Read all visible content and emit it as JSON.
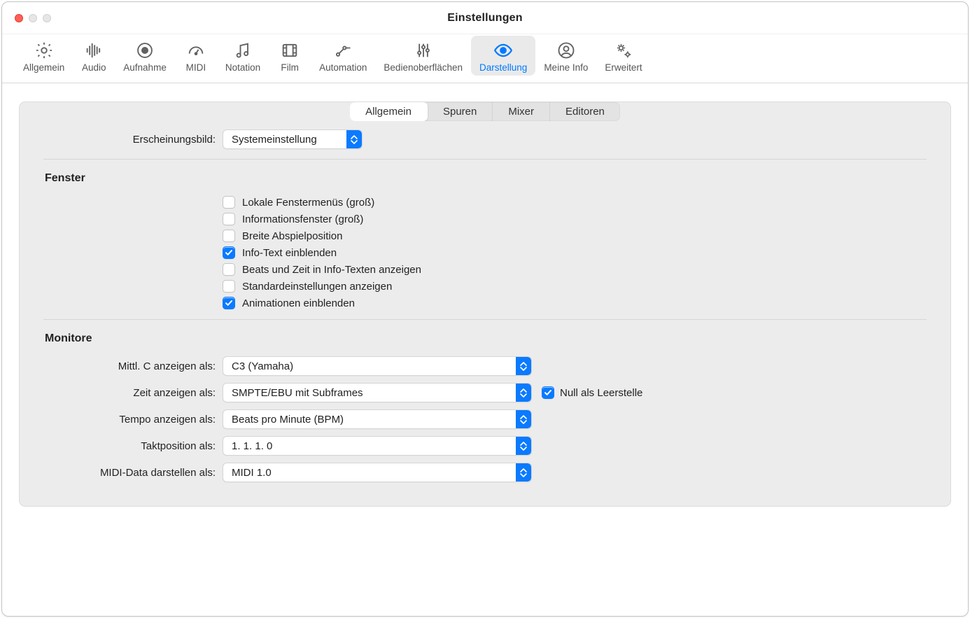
{
  "window": {
    "title": "Einstellungen"
  },
  "toolbar": {
    "items": [
      {
        "label": "Allgemein"
      },
      {
        "label": "Audio"
      },
      {
        "label": "Aufnahme"
      },
      {
        "label": "MIDI"
      },
      {
        "label": "Notation"
      },
      {
        "label": "Film"
      },
      {
        "label": "Automation"
      },
      {
        "label": "Bedienoberflächen"
      },
      {
        "label": "Darstellung"
      },
      {
        "label": "Meine Info"
      },
      {
        "label": "Erweitert"
      }
    ],
    "active_index": 8
  },
  "subtabs": {
    "items": [
      {
        "label": "Allgemein"
      },
      {
        "label": "Spuren"
      },
      {
        "label": "Mixer"
      },
      {
        "label": "Editoren"
      }
    ],
    "active_index": 0
  },
  "appearance": {
    "label": "Erscheinungsbild:",
    "value": "Systemeinstellung"
  },
  "sections": {
    "fenster": {
      "title": "Fenster",
      "checkboxes": [
        {
          "label": "Lokale Fenstermenüs (groß)",
          "checked": false
        },
        {
          "label": "Informationsfenster (groß)",
          "checked": false
        },
        {
          "label": "Breite Abspielposition",
          "checked": false
        },
        {
          "label": "Info-Text einblenden",
          "checked": true
        },
        {
          "label": "Beats und Zeit in Info-Texten anzeigen",
          "checked": false
        },
        {
          "label": "Standardeinstellungen anzeigen",
          "checked": false
        },
        {
          "label": "Animationen einblenden",
          "checked": true
        }
      ]
    },
    "monitore": {
      "title": "Monitore",
      "rows": [
        {
          "label": "Mittl. C anzeigen als:",
          "value": "C3 (Yamaha)"
        },
        {
          "label": "Zeit anzeigen als:",
          "value": "SMPTE/EBU mit Subframes",
          "aux_cb": {
            "label": "Null als Leerstelle",
            "checked": true
          }
        },
        {
          "label": "Tempo anzeigen als:",
          "value": "Beats pro Minute (BPM)"
        },
        {
          "label": "Taktposition als:",
          "value": "1. 1. 1.  0"
        },
        {
          "label": "MIDI-Data darstellen als:",
          "value": "MIDI 1.0"
        }
      ]
    }
  }
}
